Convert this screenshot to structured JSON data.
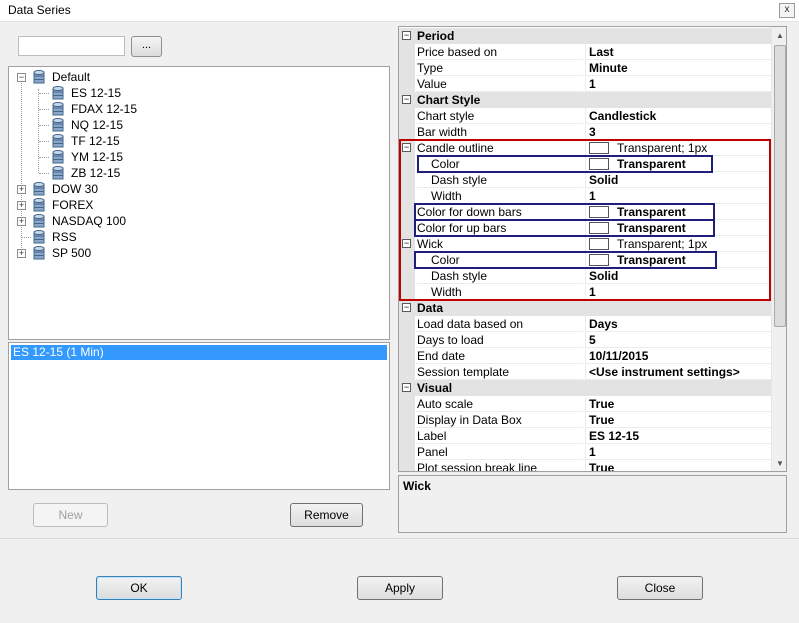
{
  "window": {
    "title": "Data Series",
    "close_label": "x"
  },
  "left": {
    "search_value": "",
    "browse_label": "...",
    "tree": {
      "default": "Default",
      "children": [
        "ES 12-15",
        "FDAX 12-15",
        "NQ 12-15",
        "TF 12-15",
        "YM 12-15",
        "ZB 12-15"
      ],
      "groups": [
        "DOW 30",
        "FOREX",
        "NASDAQ 100",
        "RSS",
        "SP 500"
      ]
    },
    "selected_series": "ES 12-15 (1 Min)",
    "new_label": "New",
    "remove_label": "Remove"
  },
  "grid": {
    "period": {
      "title": "Period",
      "price_name": "Price based on",
      "price_value": "Last",
      "type_name": "Type",
      "type_value": "Minute",
      "value_name": "Value",
      "value_value": "1"
    },
    "chart_style": {
      "title": "Chart Style",
      "style_name": "Chart style",
      "style_value": "Candlestick",
      "barwidth_name": "Bar width",
      "barwidth_value": "3",
      "outline_name": "Candle outline",
      "outline_value": "Transparent; 1px",
      "color_name": "Color",
      "color_value": "Transparent",
      "dash_name": "Dash style",
      "dash_value": "Solid",
      "width_name": "Width",
      "width_value": "1",
      "down_name": "Color for down bars",
      "down_value": "Transparent",
      "up_name": "Color for up bars",
      "up_value": "Transparent",
      "wick_name": "Wick",
      "wick_value": "Transparent; 1px",
      "wick_color_name": "Color",
      "wick_color_value": "Transparent",
      "wick_dash_name": "Dash style",
      "wick_dash_value": "Solid",
      "wick_width_name": "Width",
      "wick_width_value": "1"
    },
    "data": {
      "title": "Data",
      "load_name": "Load data based on",
      "load_value": "Days",
      "days_name": "Days to load",
      "days_value": "5",
      "end_name": "End date",
      "end_value": "10/11/2015",
      "session_name": "Session template",
      "session_value": "<Use instrument settings>"
    },
    "visual": {
      "title": "Visual",
      "auto_name": "Auto scale",
      "auto_value": "True",
      "databox_name": "Display in Data Box",
      "databox_value": "True",
      "label_name": "Label",
      "label_value": "ES 12-15",
      "panel_name": "Panel",
      "panel_value": "1",
      "break_name": "Plot session break line",
      "break_value": "True"
    }
  },
  "description": {
    "title": "Wick"
  },
  "buttons": {
    "ok": "OK",
    "apply": "Apply",
    "close": "Close"
  },
  "colors": {
    "highlight": "#3399ff",
    "red_frame": "#c00000",
    "blue_frame": "#1f1f7a"
  }
}
